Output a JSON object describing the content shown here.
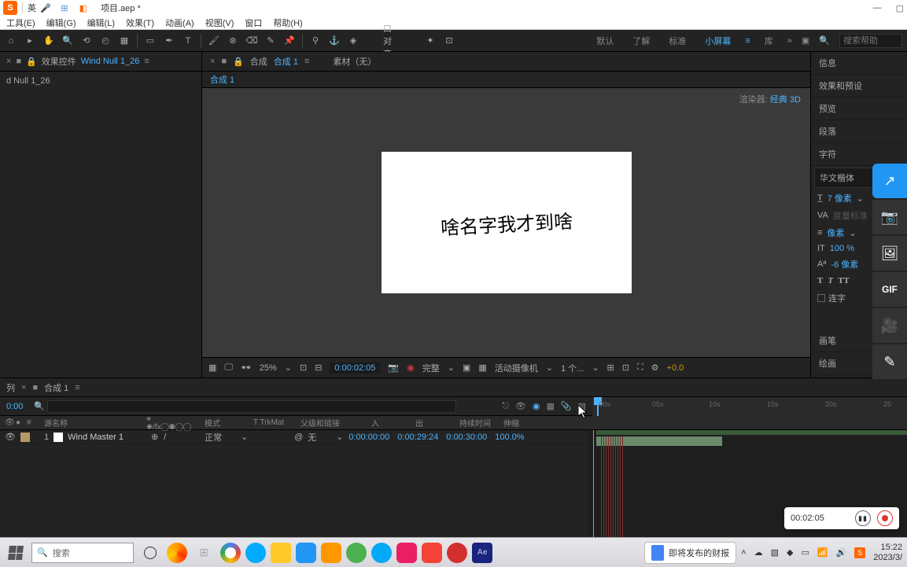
{
  "titlebar": {
    "ime_letter": "S",
    "lang": "英",
    "filename": "项目.aep *"
  },
  "menu": [
    "工具(E)",
    "编辑(G)",
    "编辑(L)",
    "效果(T)",
    "动画(A)",
    "视图(V)",
    "窗口",
    "帮助(H)"
  ],
  "toolbar": {
    "align": "口 对齐",
    "workspaces": [
      "默认",
      "了解",
      "标准",
      "小屏幕",
      "库"
    ],
    "active_ws": 3,
    "search_placeholder": "搜索帮助"
  },
  "left": {
    "tab_prefix": "效果控件",
    "tab_blue": "Wind Null 1_26",
    "layer": "d Null 1_26"
  },
  "center": {
    "tab1_prefix": "合成",
    "tab1_blue": "合成 1",
    "tab2": "素材（无）",
    "sub_blue": "合成 1",
    "render_label": "渲染器:",
    "render_value": "经典 3D",
    "canvas_text": "啥名字我才到啥",
    "zoom": "25%",
    "timecode": "0:00:02:05",
    "res": "完整",
    "camera": "活动摄像机",
    "viewcount": "1 个...",
    "exposure": "+0.0"
  },
  "right": {
    "sections": [
      "信息",
      "效果和预设",
      "预览",
      "段落",
      "字符"
    ],
    "font": "华文楷体",
    "size_val": "7 像素",
    "size_val2": "像素",
    "pct": "100 %",
    "px6": "-6 像素",
    "liga": "连字",
    "brush": "画笔",
    "paint": "绘画"
  },
  "timeline": {
    "tabs": [
      "列",
      "合成 1"
    ],
    "time": "0:00",
    "search_ph": "",
    "ruler": [
      ":00s",
      "05s",
      "10s",
      "15s",
      "20s",
      "25"
    ],
    "cols": {
      "hash": "#",
      "name": "源名称",
      "mode": "模式",
      "trk": "T TrkMat",
      "parent": "父级和链接",
      "in": "入",
      "out": "出",
      "dur": "持续时间",
      "stretch": "伸缩"
    },
    "row": {
      "num": "1",
      "name": "Wind Master 1",
      "mode": "正常",
      "parent": "无",
      "in": "0:00:00:00",
      "out": "0:00:29:24",
      "dur": "0:00:30:00",
      "stretch": "100.0%"
    }
  },
  "rec": {
    "time": "00:02:05"
  },
  "taskbar": {
    "search": "搜索",
    "doc": "即将发布的财报",
    "time": "15:22",
    "date": "2023/3/"
  }
}
